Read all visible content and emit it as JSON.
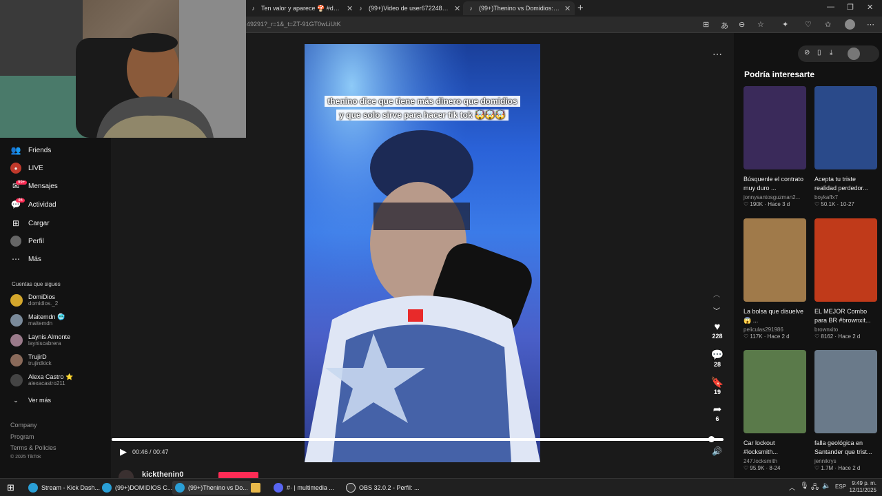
{
  "browser": {
    "tabs": [
      {
        "title": "Ten valor y aparece 🍄 #domidios",
        "active": false
      },
      {
        "title": "(99+)Video de user67224866502 (@",
        "active": false
      },
      {
        "title": "(99+)Thenino vs Domidios: TikTok",
        "active": true
      }
    ],
    "url": "49291?_r=1&_t=ZT-91GT0wLiUtK"
  },
  "sidebar": {
    "nav": [
      {
        "label": "Friends",
        "icon": "friends-icon"
      },
      {
        "label": "LIVE",
        "icon": "live-icon"
      },
      {
        "label": "Mensajes",
        "icon": "messages-icon",
        "badge": "99+"
      },
      {
        "label": "Actividad",
        "icon": "activity-icon",
        "badge": "46"
      },
      {
        "label": "Cargar",
        "icon": "upload-icon"
      },
      {
        "label": "Perfil",
        "icon": "profile-icon"
      },
      {
        "label": "Más",
        "icon": "more-icon"
      }
    ],
    "following_title": "Cuentas que sigues",
    "following": [
      {
        "name": "DomiDios",
        "handle": "domidios._2"
      },
      {
        "name": "Maitemdn 🥶",
        "handle": "maitemdn"
      },
      {
        "name": "Laynis Almonte",
        "handle": "layniscabrera"
      },
      {
        "name": "TrujirD",
        "handle": "trujirdkick"
      },
      {
        "name": "Alexa Castro ⭐",
        "handle": "alexacastro211"
      }
    ],
    "see_more": "Ver más",
    "footer": [
      "Company",
      "Program",
      "Terms & Policies"
    ],
    "copyright": "© 2025 TikTok"
  },
  "video": {
    "caption_line1": "thenino dice que tiene más dinero que domidios",
    "caption_line2": "y que solo sirve para hacer tik tok 🤯🤯🤯",
    "likes": "228",
    "comments": "28",
    "saves": "19",
    "shares": "6",
    "time": "00:46 / 00:47",
    "progress": 0.98,
    "author": "kickthenin0"
  },
  "recommendations": {
    "title": "Podría interesarte",
    "items": [
      {
        "title": "Búsquenle el contrato muy duro ...",
        "user": "jonnysantosguzman2...",
        "likes": "190K",
        "age": "Hace 3 d",
        "color": "#3a2a5a"
      },
      {
        "title": "Acepta tu triste realidad perdedor...",
        "user": "boykaffx7",
        "likes": "50.1K",
        "age": "10-27",
        "color": "#2a4a8a"
      },
      {
        "title": "La bolsa que disuelve😱 ...",
        "user": "peliculas291986",
        "likes": "117K",
        "age": "Hace 2 d",
        "color": "#a07a4a"
      },
      {
        "title": "EL MEJOR Combo para BR #brownxit...",
        "user": "brownxito",
        "likes": "8162",
        "age": "Hace 2 d",
        "color": "#c03a1a"
      },
      {
        "title": "Car lockout #locksmith...",
        "user": "247.locksmith",
        "likes": "95.9K",
        "age": "8-24",
        "color": "#5a7a4a"
      },
      {
        "title": "falla geológica en Santander que trist...",
        "user": "jennikrys",
        "likes": "1.7M",
        "age": "Hace 2 d",
        "color": "#6a7a8a"
      }
    ]
  },
  "taskbar": {
    "items": [
      {
        "label": "Stream - Kick Dash...",
        "color": "#2a9fd6"
      },
      {
        "label": "(99+)DOMIDIOS C...",
        "color": "#2a9fd6"
      },
      {
        "label": "(99+)Thenino vs Do...",
        "color": "#2a9fd6"
      },
      {
        "label": "",
        "color": "#e8b84a"
      },
      {
        "label": "#· | multimedia ...",
        "color": "#5865f2"
      },
      {
        "label": "OBS 32.0.2 - Perfil: ...",
        "color": "#333333"
      }
    ],
    "lang": "ESP",
    "time": "9:49 p. m.",
    "date": "12/11/2025"
  }
}
